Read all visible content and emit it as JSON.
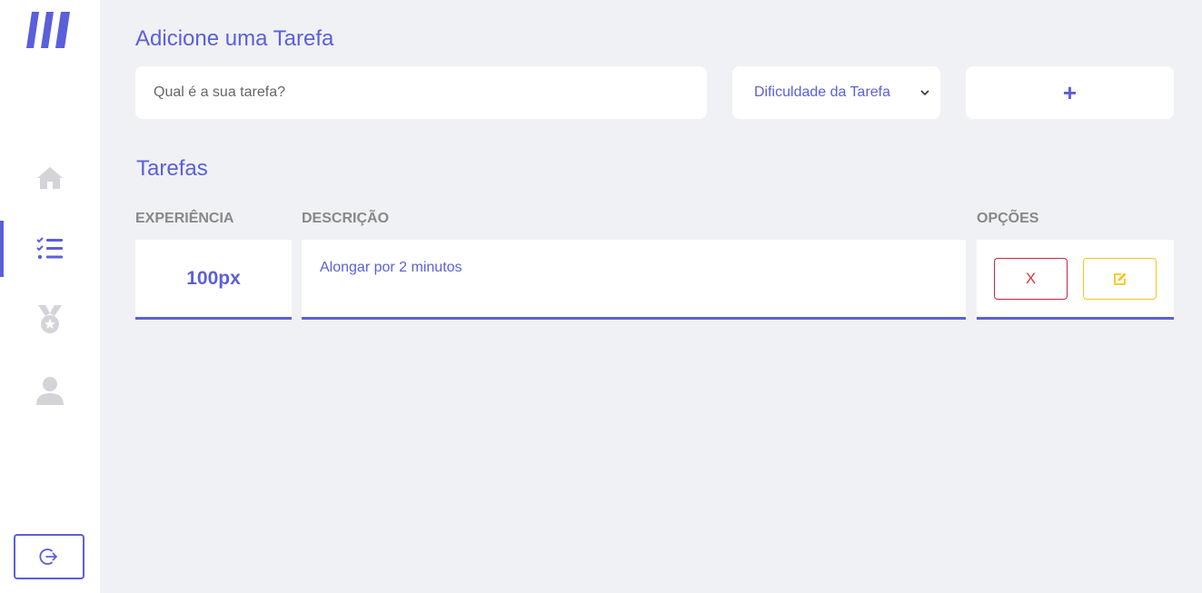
{
  "sidebar": {
    "logo": "app-logo",
    "nav": [
      {
        "icon": "home-icon",
        "active": false
      },
      {
        "icon": "task-list-icon",
        "active": true
      },
      {
        "icon": "medal-icon",
        "active": false
      },
      {
        "icon": "user-icon",
        "active": false
      }
    ],
    "logout_icon": "logout-icon"
  },
  "add_task": {
    "heading": "Adicione uma Tarefa",
    "input_placeholder": "Qual é a sua tarefa?",
    "input_value": "",
    "difficulty_label": "Dificuldade da Tarefa",
    "add_label": "+"
  },
  "tasks": {
    "heading": "Tarefas",
    "columns": [
      "EXPERIÊNCIA",
      "DESCRIÇÃO",
      "OPÇÕES"
    ],
    "rows": [
      {
        "experience": "100px",
        "description": "Alongar por 2 minutos",
        "delete_label": "X"
      }
    ]
  },
  "colors": {
    "accent": "#5b5fd9",
    "background": "#f0f1f4",
    "danger": "#dc3545",
    "warning": "#f5c518",
    "icon_inactive": "#d4d4d8"
  }
}
